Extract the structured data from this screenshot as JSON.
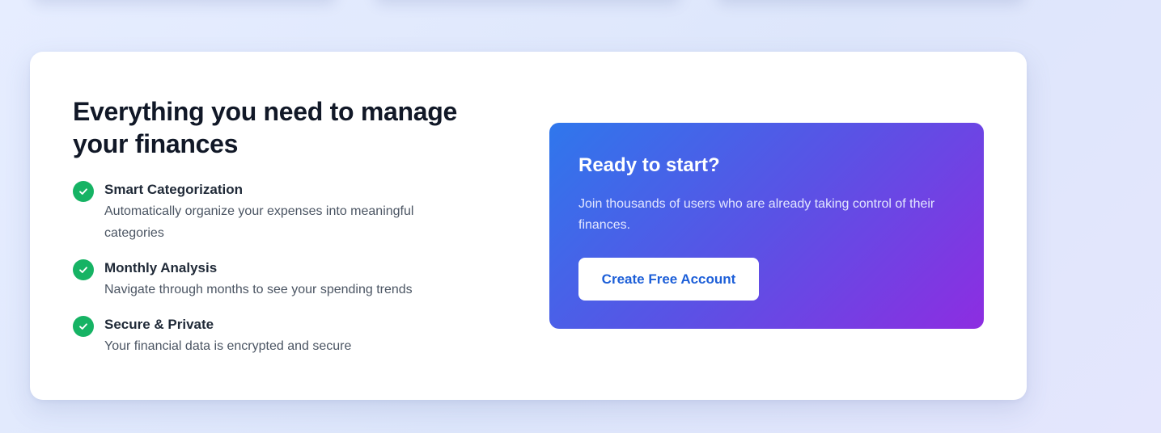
{
  "features_section": {
    "heading": "Everything you need to manage your finances",
    "items": [
      {
        "icon": "check-circle-icon",
        "title": "Smart Categorization",
        "description": "Automatically organize your expenses into meaningful categories"
      },
      {
        "icon": "check-circle-icon",
        "title": "Monthly Analysis",
        "description": "Navigate through months to see your spending trends"
      },
      {
        "icon": "check-circle-icon",
        "title": "Secure & Private",
        "description": "Your financial data is encrypted and secure"
      }
    ]
  },
  "cta": {
    "title": "Ready to start?",
    "description": "Join thousands of users who are already taking control of their finances.",
    "button_label": "Create Free Account"
  },
  "colors": {
    "check_green": "#16b364",
    "cta_gradient_start": "#2f77ec",
    "cta_gradient_end": "#8d2de1",
    "button_text": "#1d5fd8"
  }
}
